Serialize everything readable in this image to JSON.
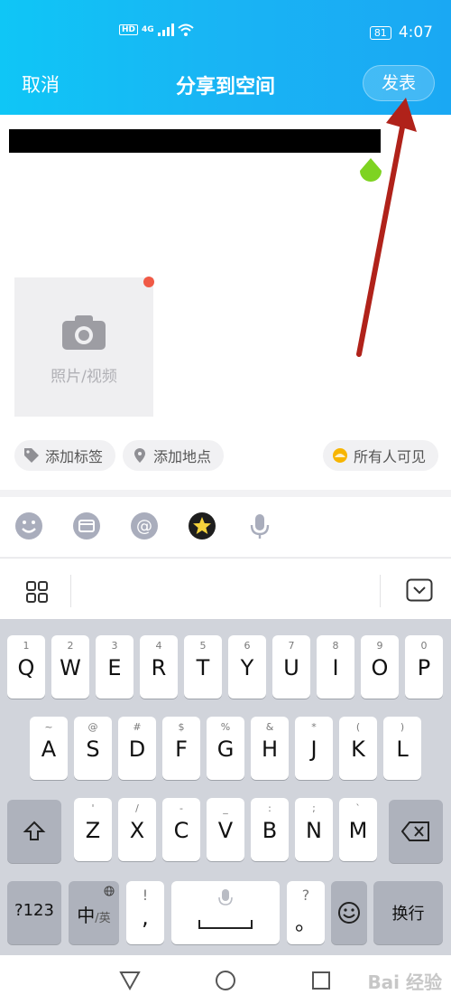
{
  "status": {
    "net": "HD",
    "sig": "4G",
    "battery": "81",
    "time": "4:07"
  },
  "header": {
    "cancel": "取消",
    "title": "分享到空间",
    "publish": "发表"
  },
  "editor": {
    "photo_label": "照片/视频"
  },
  "chips": {
    "tag": "添加标签",
    "location": "添加地点",
    "visibility": "所有人可见"
  },
  "keyboard": {
    "row1": [
      {
        "sub": "1",
        "main": "Q"
      },
      {
        "sub": "2",
        "main": "W"
      },
      {
        "sub": "3",
        "main": "E"
      },
      {
        "sub": "4",
        "main": "R"
      },
      {
        "sub": "5",
        "main": "T"
      },
      {
        "sub": "6",
        "main": "Y"
      },
      {
        "sub": "7",
        "main": "U"
      },
      {
        "sub": "8",
        "main": "I"
      },
      {
        "sub": "9",
        "main": "O"
      },
      {
        "sub": "0",
        "main": "P"
      }
    ],
    "row2": [
      {
        "sub": "~",
        "main": "A"
      },
      {
        "sub": "@",
        "main": "S"
      },
      {
        "sub": "#",
        "main": "D"
      },
      {
        "sub": "$",
        "main": "F"
      },
      {
        "sub": "%",
        "main": "G"
      },
      {
        "sub": "&",
        "main": "H"
      },
      {
        "sub": "*",
        "main": "J"
      },
      {
        "sub": "(",
        "main": "K"
      },
      {
        "sub": ")",
        "main": "L"
      }
    ],
    "row3": [
      {
        "sub": "'",
        "main": "Z"
      },
      {
        "sub": "/",
        "main": "X"
      },
      {
        "sub": "-",
        "main": "C"
      },
      {
        "sub": "_",
        "main": "V"
      },
      {
        "sub": ":",
        "main": "B"
      },
      {
        "sub": ";",
        "main": "N"
      },
      {
        "sub": "`",
        "main": "M"
      }
    ],
    "num_label": "?123",
    "lang_main": "中",
    "lang_sub": "/英",
    "comma_sub": "!",
    "comma_main": ",",
    "period_sub": "?",
    "period_main": "。",
    "enter_label": "换行"
  },
  "watermark": "Bai 经验",
  "colors": {
    "header_start": "#0fc6f6",
    "header_end": "#1aa8f3",
    "annotation": "#b0221a",
    "dot": "#f05a46"
  }
}
